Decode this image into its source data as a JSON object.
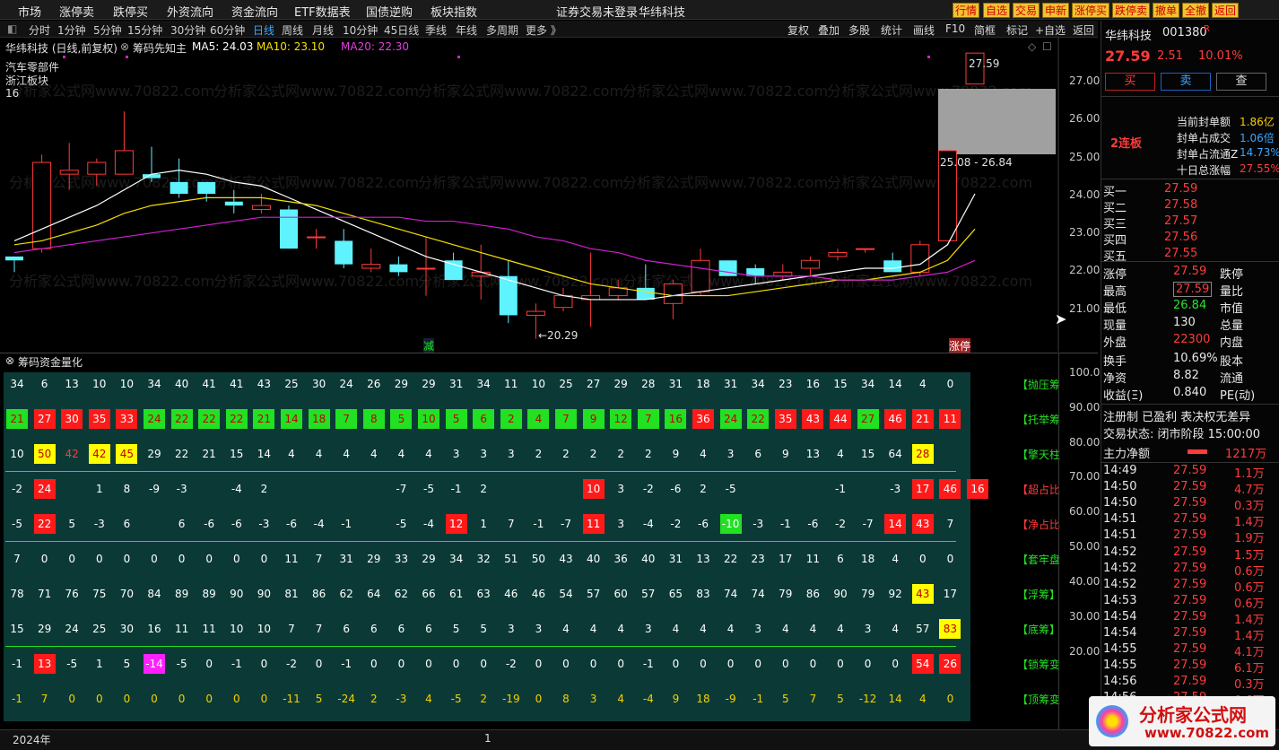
{
  "menu": [
    "市场",
    "涨停卖",
    "跌停买",
    "外资流向",
    "资金流向",
    "ETF数据表",
    "国债逆购",
    "板块指数"
  ],
  "warning": "证券交易未登录",
  "warning2": "华纬科技",
  "top_buttons": [
    "行情",
    "自选",
    "交易",
    "申新",
    "涨停买",
    "跌停卖",
    "撤单",
    "全撤",
    "返回"
  ],
  "periods": [
    "分时",
    "1分钟",
    "5分钟",
    "15分钟",
    "30分钟",
    "60分钟",
    "日线",
    "周线",
    "月线",
    "10分钟",
    "45日线",
    "季线",
    "年线",
    "多周期",
    "更多 》"
  ],
  "active_period": "日线",
  "right_tools": [
    "复权",
    "叠加",
    "多股",
    "统计",
    "画线",
    "F10",
    "简框",
    "标记",
    "+自选",
    "返回"
  ],
  "chart_header": {
    "name": "华纬科技 (日线,前复权)",
    "indicator": "筹码先知主",
    "ma5": "MA5: 24.03",
    "ma10": "MA10: 23.10",
    "ma20": "MA20: 22.30"
  },
  "sector": {
    "line1": "汽车零部件",
    "line2": "浙江板块",
    "line3": "16"
  },
  "price_axis": [
    "27.00",
    "26.00",
    "25.00",
    "24.00",
    "23.00",
    "22.00",
    "21.00"
  ],
  "annotations": {
    "high": "27.59",
    "low": "←20.29",
    "range": "25.08 - 26.84",
    "tag1": "减",
    "tag2": "涨停"
  },
  "lower_title": "筹码资金量化",
  "lower_axis": [
    "100.0",
    "90.00",
    "80.00",
    "70.00",
    "60.00",
    "50.00",
    "40.00",
    "30.00",
    "20.00"
  ],
  "row_labels": [
    "【抛压筹",
    "【托举筹",
    "【擎天柱",
    "【超占比",
    "【净占比",
    "【套牢盘",
    "【浮筹】",
    "【底筹】",
    "【锁筹变",
    "【顶筹变"
  ],
  "chart_data": {
    "type": "candlestick",
    "candles": [
      {
        "o": 22.4,
        "c": 22.3,
        "h": 22.4,
        "l": 22.0
      },
      {
        "o": 22.6,
        "c": 24.8,
        "h": 25.0,
        "l": 22.5
      },
      {
        "o": 24.5,
        "c": 24.6,
        "h": 25.3,
        "l": 24.1
      },
      {
        "o": 24.5,
        "c": 24.8,
        "h": 24.9,
        "l": 24.2
      },
      {
        "o": 24.5,
        "c": 25.1,
        "h": 26.1,
        "l": 24.5
      },
      {
        "o": 24.5,
        "c": 24.4,
        "h": 25.2,
        "l": 24.3
      },
      {
        "o": 24.3,
        "c": 24.0,
        "h": 24.9,
        "l": 23.9
      },
      {
        "o": 24.3,
        "c": 24.0,
        "h": 24.3,
        "l": 23.8
      },
      {
        "o": 23.8,
        "c": 23.7,
        "h": 24.1,
        "l": 23.5
      },
      {
        "o": 23.6,
        "c": 23.7,
        "h": 24.0,
        "l": 23.5
      },
      {
        "o": 23.6,
        "c": 22.6,
        "h": 23.7,
        "l": 22.6
      },
      {
        "o": 22.9,
        "c": 22.9,
        "h": 23.1,
        "l": 22.6
      },
      {
        "o": 22.8,
        "c": 22.2,
        "h": 23.1,
        "l": 22.1
      },
      {
        "o": 22.1,
        "c": 22.2,
        "h": 22.6,
        "l": 22.0
      },
      {
        "o": 22.2,
        "c": 22.0,
        "h": 22.4,
        "l": 21.9
      },
      {
        "o": 22.1,
        "c": 22.1,
        "h": 22.9,
        "l": 21.4
      },
      {
        "o": 22.3,
        "c": 21.8,
        "h": 22.5,
        "l": 21.8
      },
      {
        "o": 21.9,
        "c": 22.0,
        "h": 22.7,
        "l": 21.3
      },
      {
        "o": 21.9,
        "c": 20.9,
        "h": 22.3,
        "l": 20.7
      },
      {
        "o": 20.9,
        "c": 21.0,
        "h": 21.2,
        "l": 20.3
      },
      {
        "o": 21.1,
        "c": 21.4,
        "h": 21.6,
        "l": 21.0
      },
      {
        "o": 21.3,
        "c": 21.4,
        "h": 22.5,
        "l": 20.6
      },
      {
        "o": 21.4,
        "c": 21.6,
        "h": 21.8,
        "l": 21.3
      },
      {
        "o": 21.6,
        "c": 21.3,
        "h": 22.2,
        "l": 21.3
      },
      {
        "o": 21.2,
        "c": 21.7,
        "h": 21.8,
        "l": 20.8
      },
      {
        "o": 21.5,
        "c": 22.3,
        "h": 22.6,
        "l": 21.4
      },
      {
        "o": 22.3,
        "c": 21.9,
        "h": 22.3,
        "l": 21.9
      },
      {
        "o": 22.1,
        "c": 21.9,
        "h": 22.2,
        "l": 21.7
      },
      {
        "o": 21.9,
        "c": 22.0,
        "h": 22.2,
        "l": 21.8
      },
      {
        "o": 22.1,
        "c": 22.3,
        "h": 22.4,
        "l": 21.9
      },
      {
        "o": 22.4,
        "c": 22.5,
        "h": 22.6,
        "l": 22.3
      },
      {
        "o": 22.6,
        "c": 22.6,
        "h": 22.6,
        "l": 22.5
      },
      {
        "o": 22.3,
        "c": 22.0,
        "h": 22.5,
        "l": 22.0
      },
      {
        "o": 22.0,
        "c": 22.7,
        "h": 22.8,
        "l": 21.9
      },
      {
        "o": 22.8,
        "c": 25.1,
        "h": 25.1,
        "l": 22.8
      },
      {
        "o": 26.8,
        "c": 27.59,
        "h": 27.59,
        "l": 26.84
      }
    ],
    "ma5": [
      22.8,
      23.1,
      23.4,
      23.7,
      24.1,
      24.5,
      24.6,
      24.5,
      24.3,
      24.2,
      23.9,
      23.6,
      23.3,
      23.0,
      22.7,
      22.4,
      22.2,
      22.0,
      21.8,
      21.6,
      21.4,
      21.3,
      21.3,
      21.3,
      21.4,
      21.5,
      21.6,
      21.7,
      21.8,
      21.9,
      22.0,
      22.1,
      22.1,
      22.2,
      22.7,
      24.0
    ],
    "ma10": [
      22.7,
      22.8,
      23.0,
      23.2,
      23.5,
      23.7,
      23.8,
      23.9,
      23.9,
      23.9,
      23.8,
      23.7,
      23.5,
      23.3,
      23.1,
      22.9,
      22.7,
      22.5,
      22.3,
      22.1,
      21.9,
      21.7,
      21.6,
      21.5,
      21.4,
      21.4,
      21.4,
      21.5,
      21.6,
      21.7,
      21.8,
      21.8,
      21.9,
      22.0,
      22.3,
      23.1
    ],
    "ma20": [
      22.5,
      22.6,
      22.7,
      22.8,
      22.9,
      23.0,
      23.1,
      23.2,
      23.3,
      23.4,
      23.4,
      23.4,
      23.4,
      23.4,
      23.4,
      23.3,
      23.3,
      23.2,
      23.1,
      22.9,
      22.8,
      22.6,
      22.5,
      22.3,
      22.2,
      22.1,
      22.0,
      21.9,
      21.9,
      21.9,
      21.8,
      21.8,
      21.8,
      21.9,
      22.0,
      22.3
    ],
    "ylim": [
      20.2,
      27.8
    ]
  },
  "table_rows": [
    {
      "vals": [
        "34",
        "6",
        "13",
        "10",
        "10",
        "34",
        "40",
        "41",
        "41",
        "43",
        "25",
        "30",
        "24",
        "26",
        "29",
        "29",
        "31",
        "34",
        "11",
        "10",
        "25",
        "27",
        "29",
        "28",
        "31",
        "18",
        "31",
        "34",
        "23",
        "16",
        "15",
        "34",
        "14",
        "4",
        "0"
      ],
      "bg": [],
      "color": "#ffffff"
    },
    {
      "vals": [
        "21",
        "27",
        "30",
        "35",
        "33",
        "24",
        "22",
        "22",
        "22",
        "21",
        "14",
        "18",
        "7",
        "8",
        "5",
        "10",
        "5",
        "6",
        "2",
        "4",
        "7",
        "9",
        "12",
        "7",
        "16",
        "36",
        "24",
        "22",
        "35",
        "43",
        "44",
        "27",
        "46",
        "21",
        "11"
      ],
      "bg": [
        "g",
        "r",
        "r",
        "r",
        "r",
        "g",
        "g",
        "g",
        "g",
        "g",
        "g",
        "g",
        "g",
        "g",
        "g",
        "g",
        "g",
        "g",
        "g",
        "g",
        "g",
        "g",
        "g",
        "g",
        "g",
        "r",
        "g",
        "g",
        "r",
        "r",
        "r",
        "g",
        "r",
        "r",
        "r"
      ],
      "color": "#ffffff"
    },
    {
      "vals": [
        "10",
        "50",
        "42",
        "42",
        "45",
        "29",
        "22",
        "21",
        "15",
        "14",
        "4",
        "4",
        "4",
        "4",
        "4",
        "4",
        "3",
        "3",
        "3",
        "2",
        "2",
        "2",
        "2",
        "2",
        "9",
        "4",
        "3",
        "6",
        "9",
        "13",
        "4",
        "15",
        "64",
        "28"
      ],
      "bg": [
        "",
        "y",
        "",
        "y",
        "y",
        "",
        "",
        "",
        "",
        "",
        "",
        "",
        "",
        "",
        "",
        "",
        "",
        "",
        "",
        "",
        "",
        "",
        "",
        "",
        "",
        "",
        "",
        "",
        "",
        "",
        "",
        "",
        "",
        "y",
        ""
      ],
      "color": "#ffffff"
    },
    {
      "vals": [
        "-2",
        "24",
        "",
        "1",
        "8",
        "-9",
        "-3",
        "",
        "-4",
        "2",
        "",
        "",
        "",
        "",
        "-7",
        "-5",
        "-1",
        "2",
        "",
        "",
        "",
        "10",
        "3",
        "-2",
        "-6",
        "2",
        "-5",
        "",
        "",
        "",
        "-1",
        "",
        "-3",
        "17",
        "46",
        "16"
      ],
      "bg": [
        "",
        "r",
        "",
        "",
        "",
        "",
        "",
        "",
        "",
        "",
        "",
        "",
        "",
        "",
        "",
        "",
        "",
        "",
        "",
        "",
        "",
        "r",
        "",
        "",
        "",
        "",
        "",
        "",
        "",
        "",
        "",
        "",
        "",
        "r",
        "r",
        "r"
      ],
      "color": "#ffffff"
    },
    {
      "vals": [
        "-5",
        "22",
        "5",
        "-3",
        "6",
        "",
        "6",
        "-6",
        "-6",
        "-3",
        "-6",
        "-4",
        "-1",
        "",
        "-5",
        "-4",
        "12",
        "1",
        "7",
        "-1",
        "-7",
        "11",
        "3",
        "-4",
        "-2",
        "-6",
        "-10",
        "-3",
        "-1",
        "-6",
        "-2",
        "-7",
        "14",
        "43",
        "7"
      ],
      "bg": [
        "",
        "r",
        "",
        "",
        "",
        "",
        "",
        "",
        "",
        "",
        "",
        "",
        "",
        "",
        "",
        "",
        "r",
        "",
        "",
        "",
        "",
        "r",
        "",
        "",
        "",
        "",
        "g",
        "",
        "",
        "",
        "",
        "",
        "r",
        "r",
        ""
      ],
      "color": "#ffffff"
    },
    {
      "vals": [
        "7",
        "0",
        "0",
        "0",
        "0",
        "0",
        "0",
        "0",
        "0",
        "0",
        "11",
        "7",
        "31",
        "29",
        "33",
        "29",
        "34",
        "32",
        "51",
        "50",
        "43",
        "40",
        "36",
        "40",
        "31",
        "13",
        "22",
        "23",
        "17",
        "11",
        "6",
        "18",
        "4",
        "0",
        "0"
      ],
      "bg": [],
      "color": "#ffffff"
    },
    {
      "vals": [
        "78",
        "71",
        "76",
        "75",
        "70",
        "84",
        "89",
        "89",
        "90",
        "90",
        "81",
        "86",
        "62",
        "64",
        "62",
        "66",
        "61",
        "63",
        "46",
        "46",
        "54",
        "57",
        "60",
        "57",
        "65",
        "83",
        "74",
        "74",
        "79",
        "86",
        "90",
        "79",
        "92",
        "43",
        "17"
      ],
      "bg": [
        "",
        "",
        "",
        "",
        "",
        "",
        "",
        "",
        "",
        "",
        "",
        "",
        "",
        "",
        "",
        "",
        "",
        "",
        "",
        "",
        "",
        "",
        "",
        "",
        "",
        "",
        "",
        "",
        "",
        "",
        "",
        "",
        "",
        "y",
        ""
      ],
      "color": "#ffffff"
    },
    {
      "vals": [
        "15",
        "29",
        "24",
        "25",
        "30",
        "16",
        "11",
        "11",
        "10",
        "10",
        "7",
        "7",
        "6",
        "6",
        "6",
        "6",
        "5",
        "5",
        "3",
        "3",
        "4",
        "4",
        "4",
        "3",
        "4",
        "4",
        "4",
        "3",
        "4",
        "4",
        "4",
        "3",
        "4",
        "57",
        "83"
      ],
      "bg": [
        "",
        "",
        "",
        "",
        "",
        "",
        "",
        "",
        "",
        "",
        "",
        "",
        "",
        "",
        "",
        "",
        "",
        "",
        "",
        "",
        "",
        "",
        "",
        "",
        "",
        "",
        "",
        "",
        "",
        "",
        "",
        "",
        "",
        "",
        "y"
      ],
      "color": "#ffffff"
    },
    {
      "vals": [
        "-1",
        "13",
        "-5",
        "1",
        "5",
        "-14",
        "-5",
        "0",
        "-1",
        "0",
        "-2",
        "0",
        "-1",
        "0",
        "0",
        "0",
        "0",
        "0",
        "-2",
        "0",
        "0",
        "0",
        "0",
        "-1",
        "0",
        "0",
        "0",
        "0",
        "0",
        "0",
        "0",
        "0",
        "0",
        "54",
        "26"
      ],
      "bg": [
        "",
        "r",
        "",
        "",
        "",
        "m",
        "",
        "",
        "",
        "",
        "",
        "",
        "",
        "",
        "",
        "",
        "",
        "",
        "",
        "",
        "",
        "",
        "",
        "",
        "",
        "",
        "",
        "",
        "",
        "",
        "",
        "",
        "",
        "r",
        "r"
      ],
      "color": "#ffffff"
    },
    {
      "vals": [
        "-1",
        "7",
        "0",
        "0",
        "0",
        "0",
        "0",
        "0",
        "0",
        "0",
        "-11",
        "5",
        "-24",
        "2",
        "-3",
        "4",
        "-5",
        "2",
        "-19",
        "0",
        "8",
        "3",
        "4",
        "-4",
        "9",
        "18",
        "-9",
        "-1",
        "5",
        "7",
        "5",
        "-12",
        "14",
        "4",
        "0"
      ],
      "bg": [],
      "color": "#f5d000"
    }
  ],
  "stock": {
    "name": "华纬科技",
    "code": "001380",
    "flag": "R",
    "price": "27.59",
    "change": "2.51",
    "pct": "10.01%",
    "buy": "买",
    "sell": "卖",
    "query": "查",
    "streak": "2连板"
  },
  "seal": [
    {
      "k": "当前封单额",
      "v": "1.86亿"
    },
    {
      "k": "封单占成交",
      "v": "1.06倍"
    },
    {
      "k": "封单占流通Z",
      "v": "14.73%"
    },
    {
      "k": "十日总涨幅",
      "v": "27.55%"
    }
  ],
  "bids": [
    {
      "k": "买一",
      "v": "27.59"
    },
    {
      "k": "买二",
      "v": "27.58"
    },
    {
      "k": "买三",
      "v": "27.57"
    },
    {
      "k": "买四",
      "v": "27.56"
    },
    {
      "k": "买五",
      "v": "27.55"
    }
  ],
  "stats": [
    {
      "k": "涨停",
      "v": "27.59",
      "k2": "跌停",
      "v2": ""
    },
    {
      "k": "最高",
      "v": "27.59",
      "k2": "量比",
      "v2": ""
    },
    {
      "k": "最低",
      "v": "26.84",
      "k2": "市值",
      "v2": ""
    },
    {
      "k": "现量",
      "v": "130",
      "k2": "总量",
      "v2": ""
    },
    {
      "k": "外盘",
      "v": "22300",
      "k2": "内盘",
      "v2": ""
    },
    {
      "k": "换手",
      "v": "10.69%",
      "k2": "股本",
      "v2": ""
    },
    {
      "k": "净资",
      "v": "8.82",
      "k2": "流通",
      "v2": ""
    },
    {
      "k": "收益(Ξ)",
      "v": "0.840",
      "k2": "PE(动)",
      "v2": ""
    }
  ],
  "reg": "注册制  已盈利  表决权无差异",
  "trade_status": "交易状态: 闭市阶段 15:00:00",
  "main_net": {
    "label": "主力净额",
    "value": "1217万"
  },
  "ticks": [
    {
      "t": "14:49",
      "p": "27.59",
      "v": "1.1万"
    },
    {
      "t": "14:50",
      "p": "27.59",
      "v": "4.7万"
    },
    {
      "t": "14:50",
      "p": "27.59",
      "v": "0.3万"
    },
    {
      "t": "14:51",
      "p": "27.59",
      "v": "1.4万"
    },
    {
      "t": "14:51",
      "p": "27.59",
      "v": "1.9万"
    },
    {
      "t": "14:52",
      "p": "27.59",
      "v": "1.5万"
    },
    {
      "t": "14:52",
      "p": "27.59",
      "v": "0.6万"
    },
    {
      "t": "14:52",
      "p": "27.59",
      "v": "0.6万"
    },
    {
      "t": "14:53",
      "p": "27.59",
      "v": "0.6万"
    },
    {
      "t": "14:54",
      "p": "27.59",
      "v": "1.4万"
    },
    {
      "t": "14:54",
      "p": "27.59",
      "v": "1.4万"
    },
    {
      "t": "14:55",
      "p": "27.59",
      "v": "4.1万"
    },
    {
      "t": "14:55",
      "p": "27.59",
      "v": "6.1万"
    },
    {
      "t": "14:56",
      "p": "27.59",
      "v": "0.3万"
    },
    {
      "t": "14:56",
      "p": "27.59",
      "v": "0.6万"
    }
  ],
  "bottom": {
    "year": "2024年",
    "page": "1"
  },
  "watermark": "分析家公式网www.70822.com",
  "logo": {
    "name": "分析家公式网",
    "url": "www.70822.com"
  },
  "colors": {
    "up": "#ff3b3b",
    "down": "#5ff2ff",
    "ma5": "#ffffff",
    "ma10": "#f5e000",
    "ma20": "#d020d0",
    "panel_bg": "#0b3a36"
  }
}
